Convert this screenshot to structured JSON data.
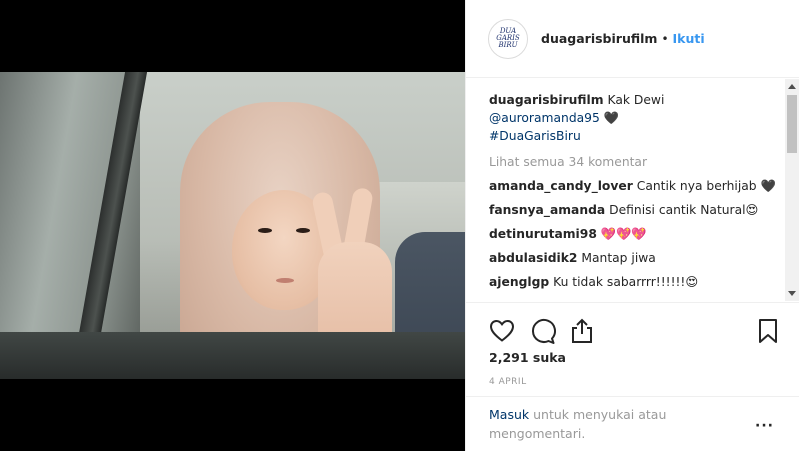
{
  "post": {
    "username": "duagarisbirufilm",
    "follow_separator": "•",
    "follow_label": "Ikuti",
    "avatar_logo": [
      "DUA",
      "GARIS",
      "BIRU"
    ]
  },
  "caption": {
    "username": "duagarisbirufilm",
    "text": "Kak Dewi",
    "mention": "@auroramanda95",
    "emoji": "🖤",
    "hashtag": "#DuaGarisBiru"
  },
  "view_all_comments": "Lihat semua 34 komentar",
  "comments": [
    {
      "user": "amanda_candy_lover",
      "text": "Cantik nya berhijab 🖤"
    },
    {
      "user": "fansnya_amanda",
      "text": "Definisi cantik Natural😍"
    },
    {
      "user": "detinurutami98",
      "text": "💖💖💖"
    },
    {
      "user": "abdulasidik2",
      "text": "Mantap jiwa"
    },
    {
      "user": "ajenglgp",
      "text": "Ku tidak sabarrrr!!!!!!😍"
    }
  ],
  "actions": {
    "like_icon": "heart-outline-icon",
    "comment_icon": "speech-bubble-icon",
    "share_icon": "share-upload-icon",
    "save_icon": "bookmark-icon"
  },
  "likes": "2,291 suka",
  "date": "4 APRIL",
  "footer": {
    "login_label": "Masuk",
    "login_text": "untuk menyukai atau mengomentari."
  },
  "more_label": "···",
  "colors": {
    "link_blue": "#3897f0",
    "dark_link": "#003569",
    "muted": "#999999"
  }
}
